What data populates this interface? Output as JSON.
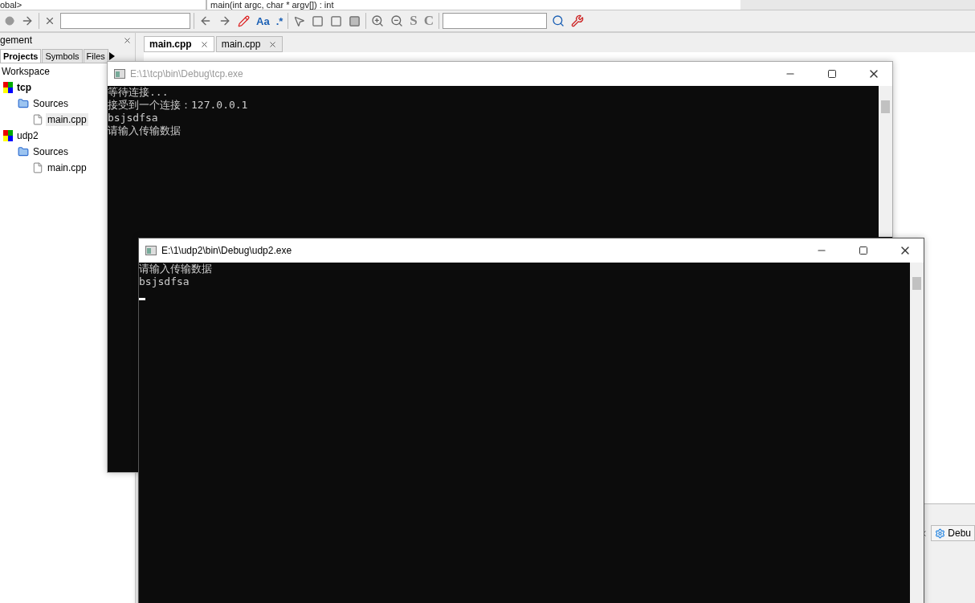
{
  "top_bar": {
    "scope": "obal>",
    "function": "main(int argc, char * argv[]) : int"
  },
  "toolbar": {
    "find_glyphs": [
      "Aa",
      ".*"
    ],
    "style_glyphs": [
      "S",
      "C"
    ]
  },
  "management": {
    "title": "gement",
    "tabs": [
      {
        "label": "Projects",
        "selected": true
      },
      {
        "label": "Symbols",
        "selected": false
      },
      {
        "label": "Files",
        "selected": false
      }
    ],
    "tree": [
      {
        "label": "Workspace",
        "kind": "workspace",
        "active": false,
        "selected": false,
        "children": [
          {
            "label": "tcp",
            "kind": "project",
            "active": true,
            "selected": false,
            "children": [
              {
                "label": "Sources",
                "kind": "folder",
                "active": false,
                "selected": false,
                "children": [
                  {
                    "label": "main.cpp",
                    "kind": "file",
                    "active": false,
                    "selected": true
                  }
                ]
              }
            ]
          },
          {
            "label": "udp2",
            "kind": "project",
            "active": false,
            "selected": false,
            "children": [
              {
                "label": "Sources",
                "kind": "folder",
                "active": false,
                "selected": false,
                "children": [
                  {
                    "label": "main.cpp",
                    "kind": "file",
                    "active": false,
                    "selected": false
                  }
                ]
              }
            ]
          }
        ]
      }
    ]
  },
  "editor_tabs": [
    {
      "label": "main.cpp",
      "selected": true
    },
    {
      "label": "main.cpp",
      "selected": false
    }
  ],
  "log_tabs": [
    {
      "label": "Debu"
    }
  ],
  "windows": [
    {
      "title": "E:\\1\\tcp\\bin\\Debug\\tcp.exe",
      "active": false,
      "cursor": false,
      "lines": [
        "等待连接...",
        "接受到一个连接：127.0.0.1",
        "bsjsdfsa",
        "请输入传输数据"
      ]
    },
    {
      "title": "E:\\1\\udp2\\bin\\Debug\\udp2.exe",
      "active": true,
      "cursor": true,
      "lines": [
        "请输入传输数据",
        "bsjsdfsa"
      ]
    }
  ]
}
